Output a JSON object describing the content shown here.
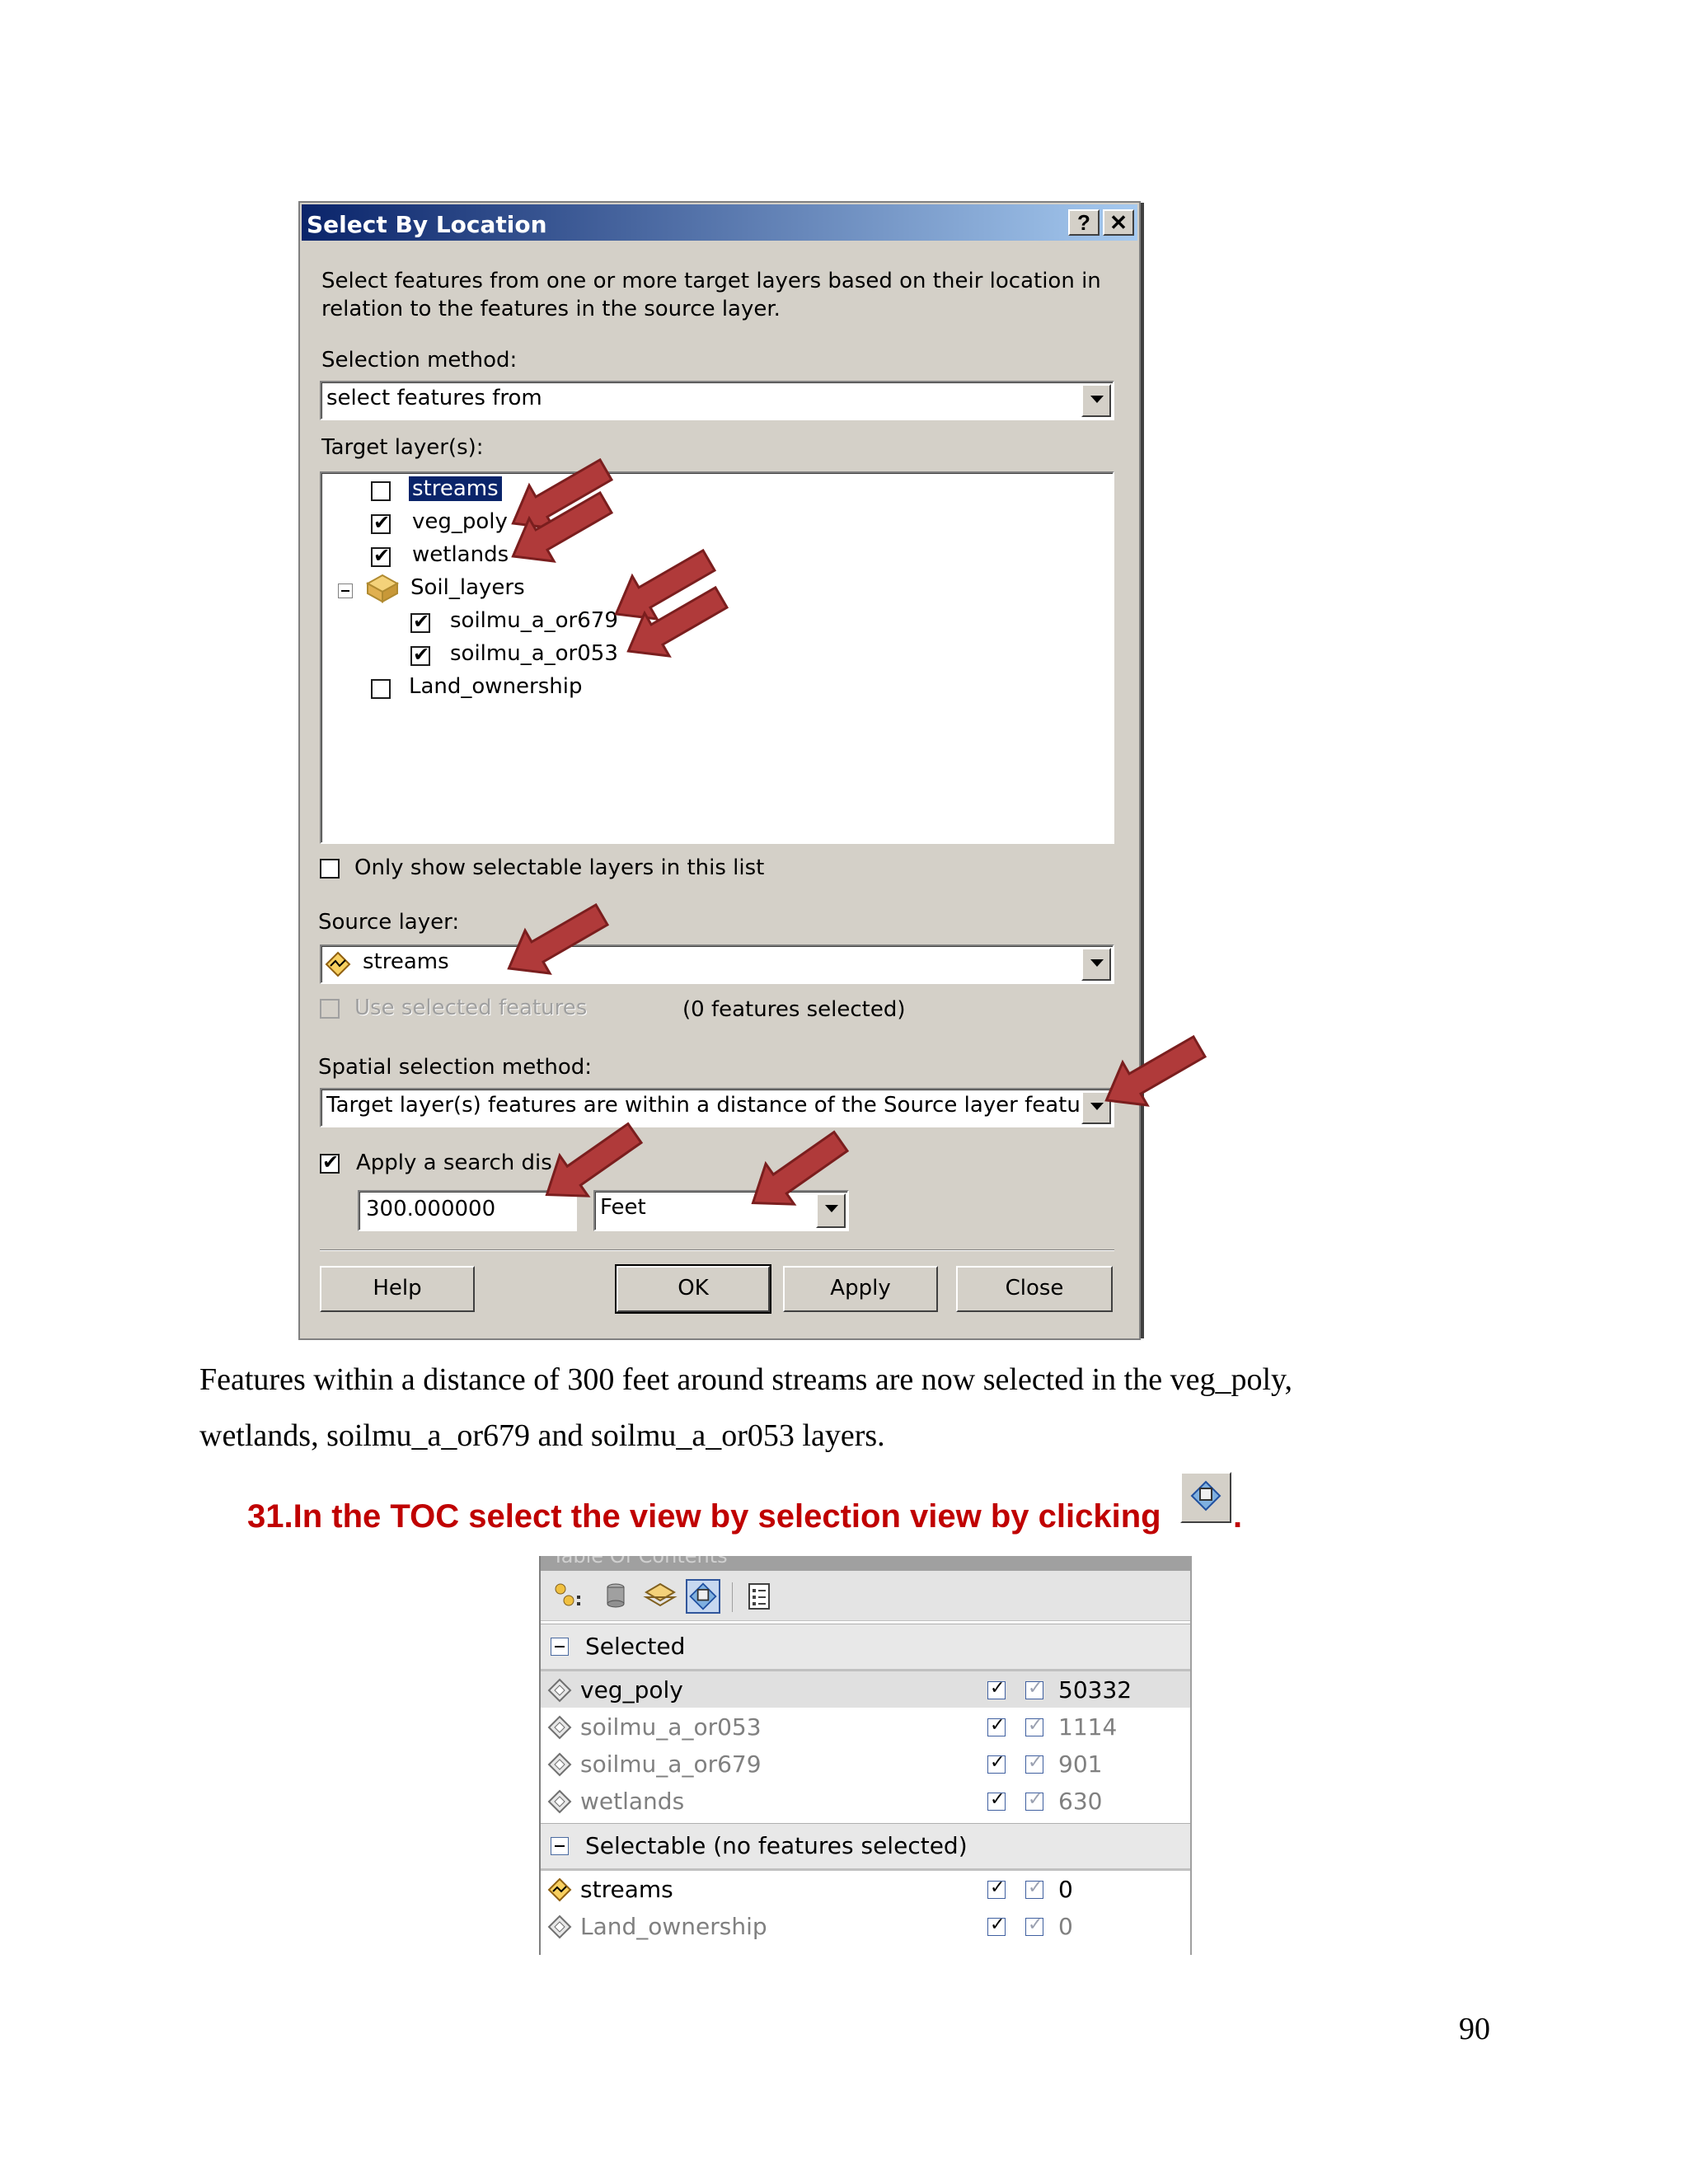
{
  "dialog": {
    "title": "Select By Location",
    "help_btn": "?",
    "close_btn": "✕",
    "description": "Select features from one or more target layers based on their location in relation to the features in the source layer.",
    "description_line1": "Select features from one or more target layers based on their location in",
    "description_line2": "relation to the features in the source layer.",
    "selection_method_label": "Selection method:",
    "selection_method_value": "select features from",
    "target_layers_label": "Target layer(s):",
    "target_layers": [
      {
        "name": "streams",
        "checked": false,
        "selected": true
      },
      {
        "name": "veg_poly",
        "checked": true
      },
      {
        "name": "wetlands",
        "checked": true
      },
      {
        "name": "Soil_layers",
        "group": true
      },
      {
        "name": "soilmu_a_or679",
        "checked": true
      },
      {
        "name": "soilmu_a_or053",
        "checked": true
      },
      {
        "name": "Land_ownership",
        "checked": false
      }
    ],
    "only_selectable_label": "Only show selectable layers in this list",
    "source_layer_label": "Source layer:",
    "source_layer_value": "streams",
    "use_selected_label": "Use selected features",
    "features_selected_text": "(0 features selected)",
    "spatial_method_label": "Spatial selection method:",
    "spatial_method_value": "Target layer(s) features are within a distance of the Source layer feature",
    "apply_search_label": "Apply a search distance",
    "apply_search_visible": "Apply a search dis",
    "distance_value": "300.000000",
    "units_value": "Feet",
    "buttons": {
      "help": "Help",
      "ok": "OK",
      "apply": "Apply",
      "close": "Close"
    }
  },
  "body": {
    "paragraph_line1": "Features within a distance of 300 feet around streams are now selected in the veg_poly,",
    "paragraph_line2": "wetlands, soilmu_a_or679 and soilmu_a_or053 layers.",
    "step": "31.In the TOC select the view by selection view by clicking",
    "step_end": ".",
    "page_number": "90"
  },
  "toc": {
    "header": "Table Of Contents",
    "groups": [
      {
        "label": "Selected",
        "rows": [
          {
            "name": "veg_poly",
            "count": "50332"
          },
          {
            "name": "soilmu_a_or053",
            "count": "1114"
          },
          {
            "name": "soilmu_a_or679",
            "count": "901"
          },
          {
            "name": "wetlands",
            "count": "630"
          }
        ]
      },
      {
        "label": "Selectable (no features selected)",
        "rows": [
          {
            "name": "streams",
            "count": "0"
          },
          {
            "name": "Land_ownership",
            "count": "0"
          }
        ]
      }
    ]
  },
  "colors": {
    "arrow": "#b03a3a",
    "step_text": "#c00000",
    "title_bar": "#0a246a"
  }
}
